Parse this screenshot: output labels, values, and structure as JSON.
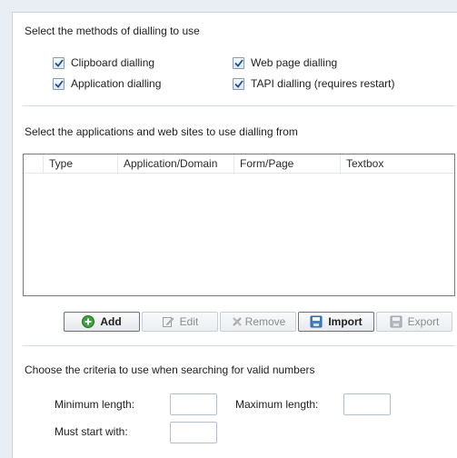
{
  "dialling_methods": {
    "title": "Select the methods of dialling to use",
    "options": [
      {
        "label": "Clipboard dialling",
        "checked": true
      },
      {
        "label": "Web page dialling",
        "checked": true
      },
      {
        "label": "Application dialling",
        "checked": true
      },
      {
        "label": "TAPI dialling (requires restart)",
        "checked": true
      }
    ]
  },
  "applications": {
    "title": "Select the applications and web sites to use dialling from",
    "columns": [
      "Type",
      "Application/Domain",
      "Form/Page",
      "Textbox"
    ],
    "rows": [],
    "buttons": {
      "add": "Add",
      "edit": "Edit",
      "remove": "Remove",
      "import": "Import",
      "export": "Export"
    }
  },
  "criteria": {
    "title": "Choose the criteria to use when searching for valid numbers",
    "min_length_label": "Minimum length:",
    "max_length_label": "Maximum length:",
    "must_start_with_label": "Must start with:",
    "min_length_value": "",
    "max_length_value": "",
    "must_start_with_value": ""
  },
  "colors": {
    "accent": "#2a7fd4",
    "add_icon_green": "#3aa33a",
    "background": "#e9eef4"
  }
}
